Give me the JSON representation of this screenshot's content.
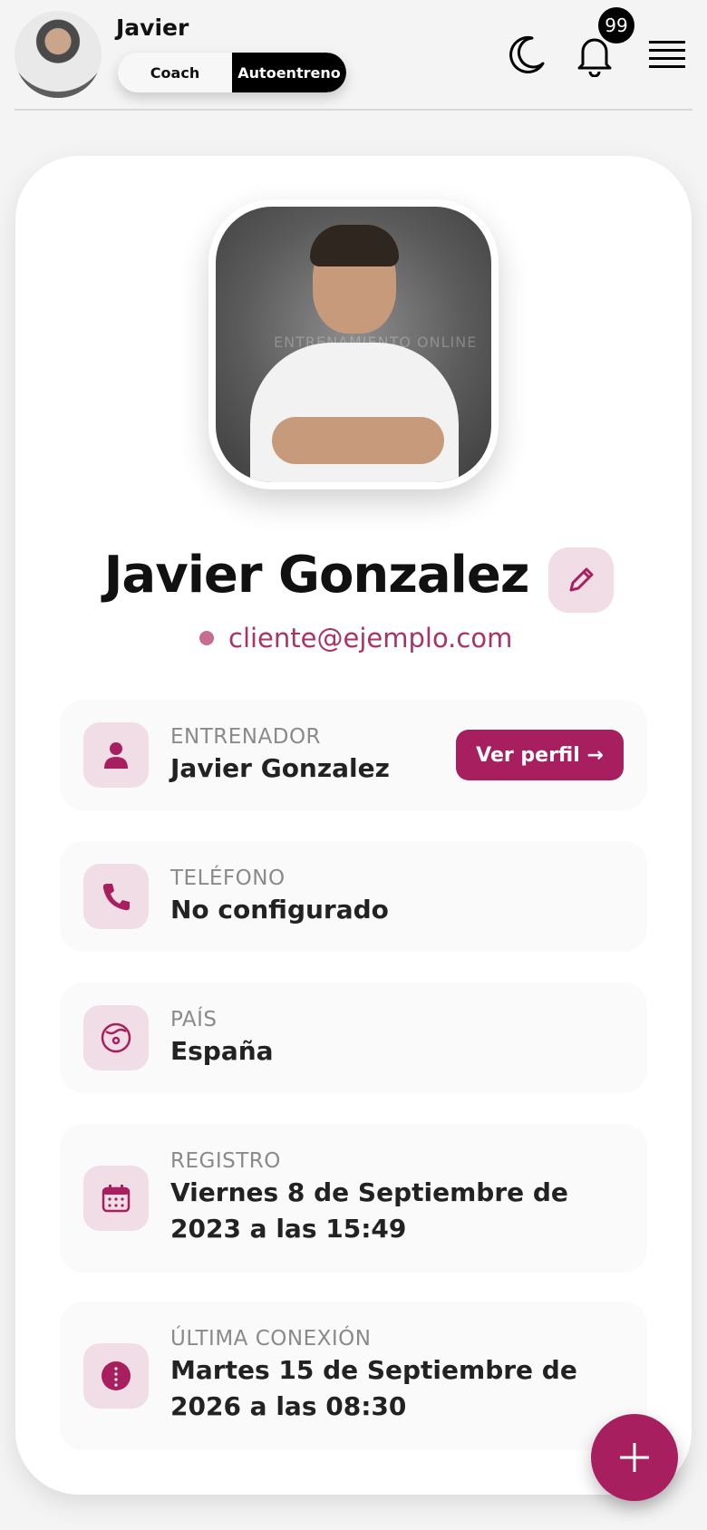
{
  "header": {
    "user_name": "Javier",
    "modes": [
      "Coach",
      "Autoentreno"
    ],
    "active_mode": "Autoentreno",
    "notification_count": "99"
  },
  "profile": {
    "full_name": "Javier Gonzalez",
    "email": "cliente@ejemplo.com",
    "photo_watermark": "ENTRENAMIENTO ONLINE"
  },
  "info": {
    "trainer": {
      "label": "ENTRENADOR",
      "value": "Javier Gonzalez",
      "button": "Ver perfil →"
    },
    "phone": {
      "label": "TELÉFONO",
      "value": "No configurado"
    },
    "country": {
      "label": "PAÍS",
      "value": "España"
    },
    "registered": {
      "label": "REGISTRO",
      "value": "Viernes 8 de Septiembre de 2023 a las 15:49"
    },
    "last_seen": {
      "label": "ÚLTIMA CONEXIÓN",
      "value": "Martes 15 de Septiembre de 2026 a las 08:30"
    }
  },
  "colors": {
    "accent": "#a71f5f",
    "accent_soft": "#f1dde5"
  },
  "icons": [
    "moon-icon",
    "bell-icon",
    "menu-icon",
    "pencil-icon",
    "user-icon",
    "phone-icon",
    "globe-icon",
    "calendar-icon",
    "info-icon",
    "plus-icon"
  ]
}
